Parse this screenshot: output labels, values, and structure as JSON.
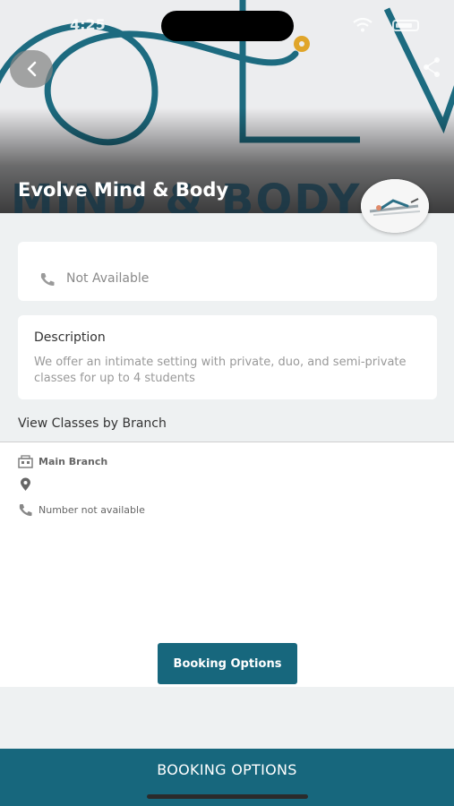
{
  "status_bar": {
    "time": "4:25"
  },
  "hero": {
    "title": "Evolve Mind & Body",
    "watermark_text": "MIND & BODY",
    "logo_text": "OLV"
  },
  "contact": {
    "phone_label": "Not Available"
  },
  "description": {
    "title": "Description",
    "body": "We offer an intimate setting with private, duo, and semi-private classes for up to 4 students"
  },
  "branches": {
    "heading": "View Classes by Branch",
    "items": [
      {
        "name": "Main Branch",
        "location": "",
        "phone": "Number not available"
      }
    ]
  },
  "booking": {
    "inline_button": "Booking Options",
    "bottom_bar": "BOOKING OPTIONS"
  },
  "colors": {
    "accent": "#17677d",
    "logo_teal": "#1d6b80",
    "logo_dot": "#e0a52a"
  },
  "icons": [
    "back-arrow-icon",
    "share-icon",
    "phone-icon",
    "building-icon",
    "location-pin-icon",
    "wifi-icon",
    "battery-icon"
  ]
}
